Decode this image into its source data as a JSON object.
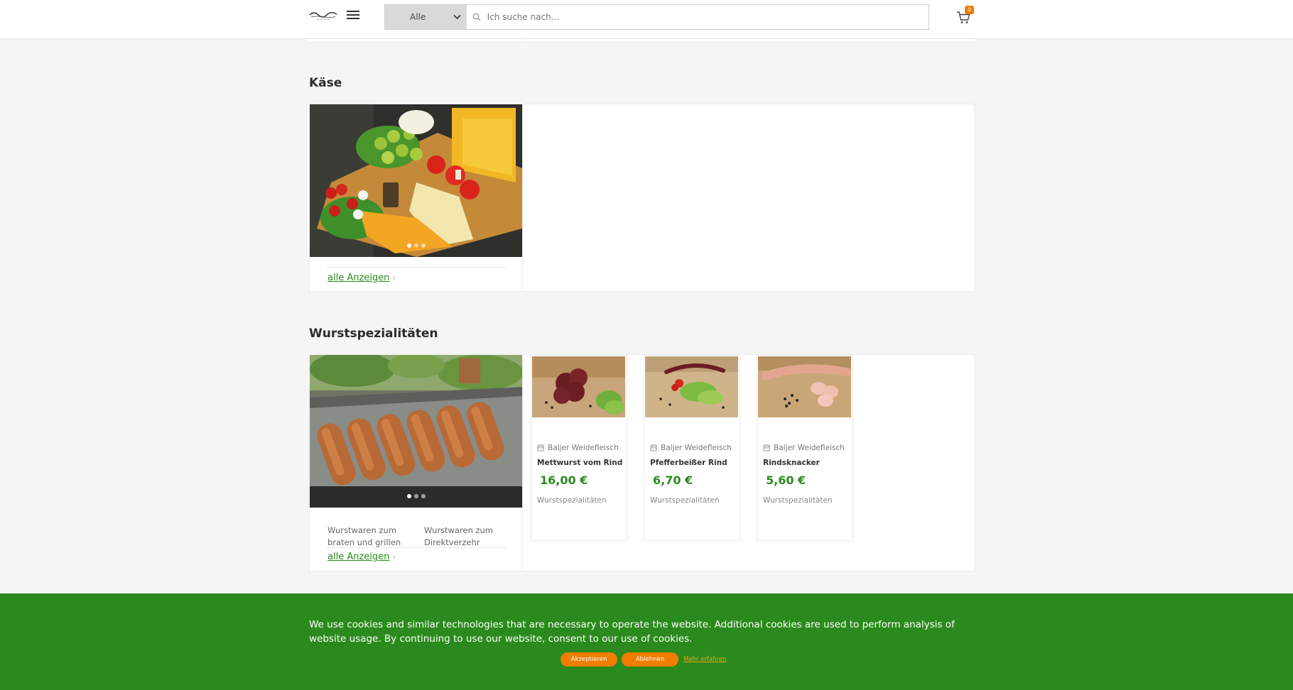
{
  "header": {
    "logo_alt": "Wir Bringen Vielfalt",
    "category_select": {
      "selected": "Alle"
    },
    "search": {
      "placeholder": "Ich suche nach..."
    },
    "cart": {
      "count": "0"
    }
  },
  "sections": [
    {
      "title": "Käse",
      "show_all": "alle Anzeigen",
      "carousel_dots": 3,
      "subcategories": [],
      "products": []
    },
    {
      "title": "Wurstspezialitäten",
      "show_all": "alle Anzeigen",
      "carousel_dots": 3,
      "subcategories": [
        "Wurstwaren zum braten und grillen",
        "Wurstwaren zum Direktverzehr"
      ],
      "products": [
        {
          "vendor": "Baljer Weidefleisch",
          "name": "Mettwurst vom Rind",
          "price": "16,00 €",
          "category": "Wurstspezialitäten"
        },
        {
          "vendor": "Baljer Weidefleisch",
          "name": "Pfefferbeißer Rind",
          "price": "6,70 €",
          "category": "Wurstspezialitäten"
        },
        {
          "vendor": "Baljer Weidefleisch",
          "name": "Rindsknacker",
          "price": "5,60 €",
          "category": "Wurstspezialitäten"
        }
      ]
    }
  ],
  "cookie_banner": {
    "text": "We use cookies and similar technologies that are necessary to operate the website. Additional cookies are used to perform analysis of website usage. By continuing to use our website, consent to our use of cookies.",
    "accept": "Akzeptieren",
    "decline": "Ablehnen",
    "more": "Mehr erfahren"
  },
  "colors": {
    "brand_green": "#2b8a1d",
    "accent_orange": "#f07d00"
  },
  "icons": [
    "menu-icon",
    "chevron-down-icon",
    "search-icon",
    "cart-icon",
    "shop-icon",
    "chevron-right-icon"
  ]
}
